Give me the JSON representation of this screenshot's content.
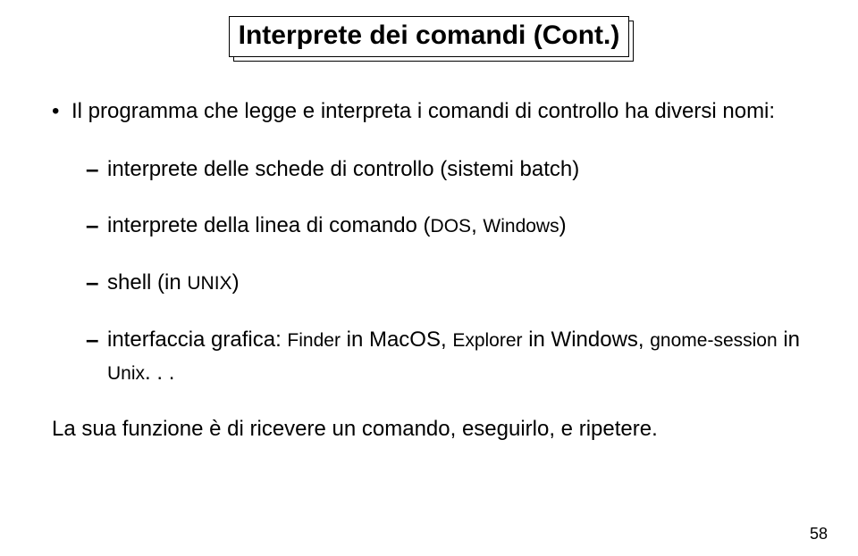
{
  "title": "Interprete dei comandi (Cont.)",
  "bullet": {
    "text": "Il programma che legge e interpreta i comandi di controllo ha diversi nomi:"
  },
  "subs": [
    {
      "text": "interprete delle schede di controllo (sistemi batch)"
    },
    {
      "pre": "interprete della linea di comando (",
      "sc1": "DOS",
      "mid": ", ",
      "sf1": "Windows",
      "post": ")"
    },
    {
      "pre": "shell (in ",
      "sc1": "UNIX",
      "post": ")"
    },
    {
      "pre": "interfaccia grafica: ",
      "sf1": "Finder",
      "mid1": " in MacOS, ",
      "sf2": "Explorer",
      "mid2": " in Windows, ",
      "sf3": "gnome-session",
      "mid3": " in ",
      "sf4": "Unix",
      "post": ". . ."
    }
  ],
  "closing": "La sua funzione è di ricevere un comando, eseguirlo, e ripetere.",
  "pageNumber": "58"
}
